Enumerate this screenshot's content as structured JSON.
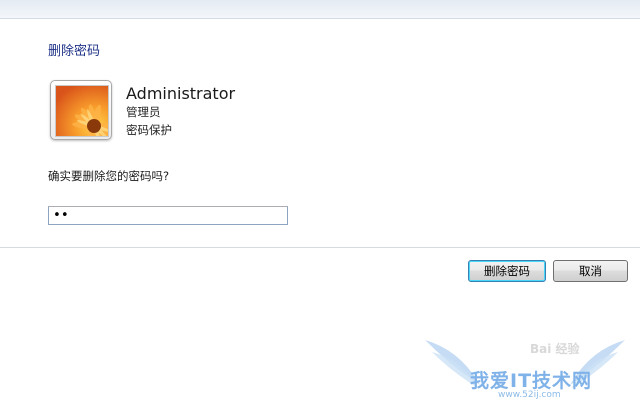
{
  "dialog": {
    "title": "删除密码",
    "user": {
      "name": "Administrator",
      "role": "管理员",
      "status": "密码保护"
    },
    "prompt": "确实要删除您的密码吗?",
    "password_field": {
      "value": "••"
    },
    "buttons": {
      "delete_password": "删除密码",
      "cancel": "取消"
    }
  },
  "watermark": {
    "brand": "Bai 经验",
    "text": "我爱IT技术网",
    "url": "www.52ij.com"
  },
  "colors": {
    "title": "#1e3287",
    "divider": "#d6dbe0",
    "watermark": "#7fb2e8"
  },
  "icons": {
    "avatar": "flower-user-picture"
  }
}
